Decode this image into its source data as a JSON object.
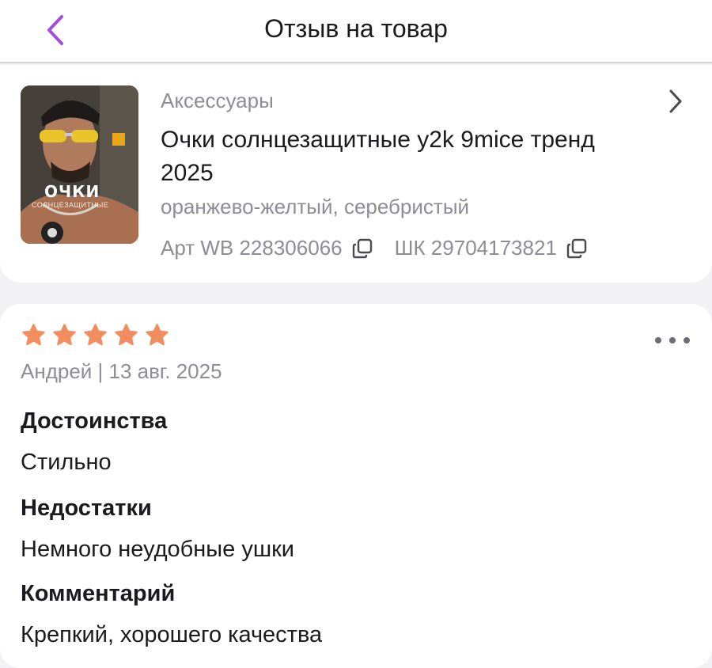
{
  "header": {
    "title": "Отзыв на товар",
    "back_icon": "chevron-left-icon",
    "accent_color": "#a04ee0"
  },
  "product": {
    "category": "Аксессуары",
    "name": "Очки солнцезащитные y2k 9mice тренд 2025",
    "color": "оранжево-желтый, серебристый",
    "art_label": "Арт WB 228306066",
    "sku_label": "ШК 29704173821",
    "thumbnail_text": "ОЧКИ",
    "thumbnail_subtext": "СОЛНЦЕЗАЩИТНЫЕ"
  },
  "review": {
    "rating": 5,
    "rating_max": 5,
    "star_color": "#f28d60",
    "author_date": "Андрей | 13 авг. 2025",
    "pros_title": "Достоинства",
    "pros_text": "Стильно",
    "cons_title": "Недостатки",
    "cons_text": "Немного неудобные ушки",
    "comment_title": "Комментарий",
    "comment_text": "Крепкий, хорошего качества"
  }
}
